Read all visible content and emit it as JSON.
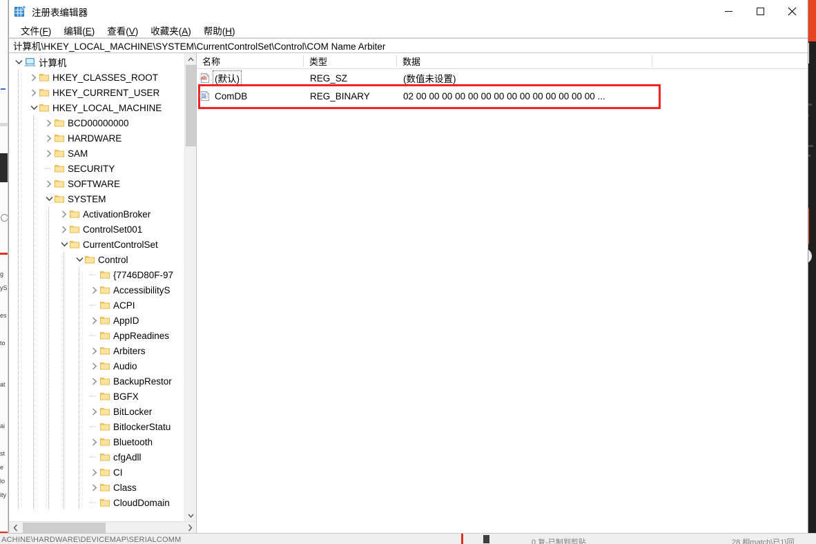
{
  "window": {
    "title": "注册表编辑器",
    "icon": "registry-editor-icon",
    "controls": {
      "minimize": "—",
      "maximize": "□",
      "close": "✕"
    }
  },
  "menubar": {
    "items": [
      {
        "label": "文件(F)",
        "accel": "F"
      },
      {
        "label": "编辑(E)",
        "accel": "E"
      },
      {
        "label": "查看(V)",
        "accel": "V"
      },
      {
        "label": "收藏夹(A)",
        "accel": "A"
      },
      {
        "label": "帮助(H)",
        "accel": "H"
      }
    ]
  },
  "address": {
    "path": "计算机\\HKEY_LOCAL_MACHINE\\SYSTEM\\CurrentControlSet\\Control\\COM Name Arbiter"
  },
  "tree": {
    "items": [
      {
        "label": "计算机",
        "depth": 0,
        "expander": "expanded",
        "icon": "computer-icon"
      },
      {
        "label": "HKEY_CLASSES_ROOT",
        "depth": 1,
        "expander": "collapsed",
        "icon": "folder-icon"
      },
      {
        "label": "HKEY_CURRENT_USER",
        "depth": 1,
        "expander": "collapsed",
        "icon": "folder-icon"
      },
      {
        "label": "HKEY_LOCAL_MACHINE",
        "depth": 1,
        "expander": "expanded",
        "icon": "folder-icon"
      },
      {
        "label": "BCD00000000",
        "depth": 2,
        "expander": "collapsed",
        "icon": "folder-icon"
      },
      {
        "label": "HARDWARE",
        "depth": 2,
        "expander": "collapsed",
        "icon": "folder-icon"
      },
      {
        "label": "SAM",
        "depth": 2,
        "expander": "collapsed",
        "icon": "folder-icon"
      },
      {
        "label": "SECURITY",
        "depth": 2,
        "expander": "leaf",
        "icon": "folder-icon"
      },
      {
        "label": "SOFTWARE",
        "depth": 2,
        "expander": "collapsed",
        "icon": "folder-icon"
      },
      {
        "label": "SYSTEM",
        "depth": 2,
        "expander": "expanded",
        "icon": "folder-icon"
      },
      {
        "label": "ActivationBroker",
        "depth": 3,
        "expander": "collapsed",
        "icon": "folder-icon"
      },
      {
        "label": "ControlSet001",
        "depth": 3,
        "expander": "collapsed",
        "icon": "folder-icon"
      },
      {
        "label": "CurrentControlSet",
        "depth": 3,
        "expander": "expanded",
        "icon": "folder-icon"
      },
      {
        "label": "Control",
        "depth": 4,
        "expander": "expanded",
        "icon": "folder-icon"
      },
      {
        "label": "{7746D80F-97",
        "depth": 5,
        "expander": "leaf",
        "icon": "folder-icon"
      },
      {
        "label": "AccessibilityS",
        "depth": 5,
        "expander": "collapsed",
        "icon": "folder-icon"
      },
      {
        "label": "ACPI",
        "depth": 5,
        "expander": "leaf",
        "icon": "folder-icon"
      },
      {
        "label": "AppID",
        "depth": 5,
        "expander": "collapsed",
        "icon": "folder-icon"
      },
      {
        "label": "AppReadines",
        "depth": 5,
        "expander": "leaf",
        "icon": "folder-icon"
      },
      {
        "label": "Arbiters",
        "depth": 5,
        "expander": "collapsed",
        "icon": "folder-icon"
      },
      {
        "label": "Audio",
        "depth": 5,
        "expander": "collapsed",
        "icon": "folder-icon"
      },
      {
        "label": "BackupRestor",
        "depth": 5,
        "expander": "collapsed",
        "icon": "folder-icon"
      },
      {
        "label": "BGFX",
        "depth": 5,
        "expander": "leaf",
        "icon": "folder-icon"
      },
      {
        "label": "BitLocker",
        "depth": 5,
        "expander": "collapsed",
        "icon": "folder-icon"
      },
      {
        "label": "BitlockerStatu",
        "depth": 5,
        "expander": "leaf",
        "icon": "folder-icon"
      },
      {
        "label": "Bluetooth",
        "depth": 5,
        "expander": "collapsed",
        "icon": "folder-icon"
      },
      {
        "label": "cfgAdll",
        "depth": 5,
        "expander": "leaf",
        "icon": "folder-icon"
      },
      {
        "label": "CI",
        "depth": 5,
        "expander": "collapsed",
        "icon": "folder-icon"
      },
      {
        "label": "Class",
        "depth": 5,
        "expander": "collapsed",
        "icon": "folder-icon"
      },
      {
        "label": "CloudDomain",
        "depth": 5,
        "expander": "leaf",
        "icon": "folder-icon"
      }
    ]
  },
  "list": {
    "columns": [
      {
        "label": "名称",
        "key": "name"
      },
      {
        "label": "类型",
        "key": "type"
      },
      {
        "label": "数据",
        "key": "data"
      }
    ],
    "rows": [
      {
        "name": "(默认)",
        "type": "REG_SZ",
        "data": "(数值未设置)",
        "icon": "string-value-icon",
        "focused": true,
        "highlighted": false
      },
      {
        "name": "ComDB",
        "type": "REG_BINARY",
        "data": "02 00 00 00 00 00 00 00 00 00 00 00 00 00 00 ...",
        "icon": "binary-value-icon",
        "focused": false,
        "highlighted": true
      }
    ]
  },
  "annotation": {
    "color": "#f42222",
    "target": "ComDB row highlight rectangle"
  },
  "scrollbars": {
    "tree_vertical_up": "▲",
    "tree_vertical_down": "▼",
    "tree_horizontal_left": "❮",
    "tree_horizontal_right": "❯"
  },
  "background": {
    "bottom_text": "ACHINE\\HARDWARE\\DEVICEMAP\\SERIALCOMM",
    "bottom_text2": "0  复-已制到剪贴",
    "bottom_text3": "28 相match\\已1\\回"
  }
}
